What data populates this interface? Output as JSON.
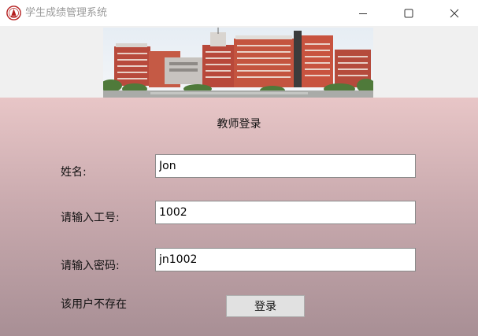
{
  "window": {
    "title": "学生成绩管理系统",
    "icon": "school-seal-icon",
    "controls": [
      "minimize-icon",
      "maximize-icon",
      "close-icon"
    ]
  },
  "banner": {
    "image": "campus-buildings-photo"
  },
  "form": {
    "heading": "教师登录",
    "name_label": "姓名:",
    "name_value": "Jon",
    "id_label": "请输入工号:",
    "id_value": "1002",
    "password_label": "请输入密码:",
    "password_value": "jn1002",
    "status_message": "该用户不存在",
    "login_label": "登录"
  },
  "colors": {
    "gradient_top": "#e8c6c7",
    "gradient_bottom": "#a88f95",
    "banner_bg": "#f0f0f0"
  }
}
